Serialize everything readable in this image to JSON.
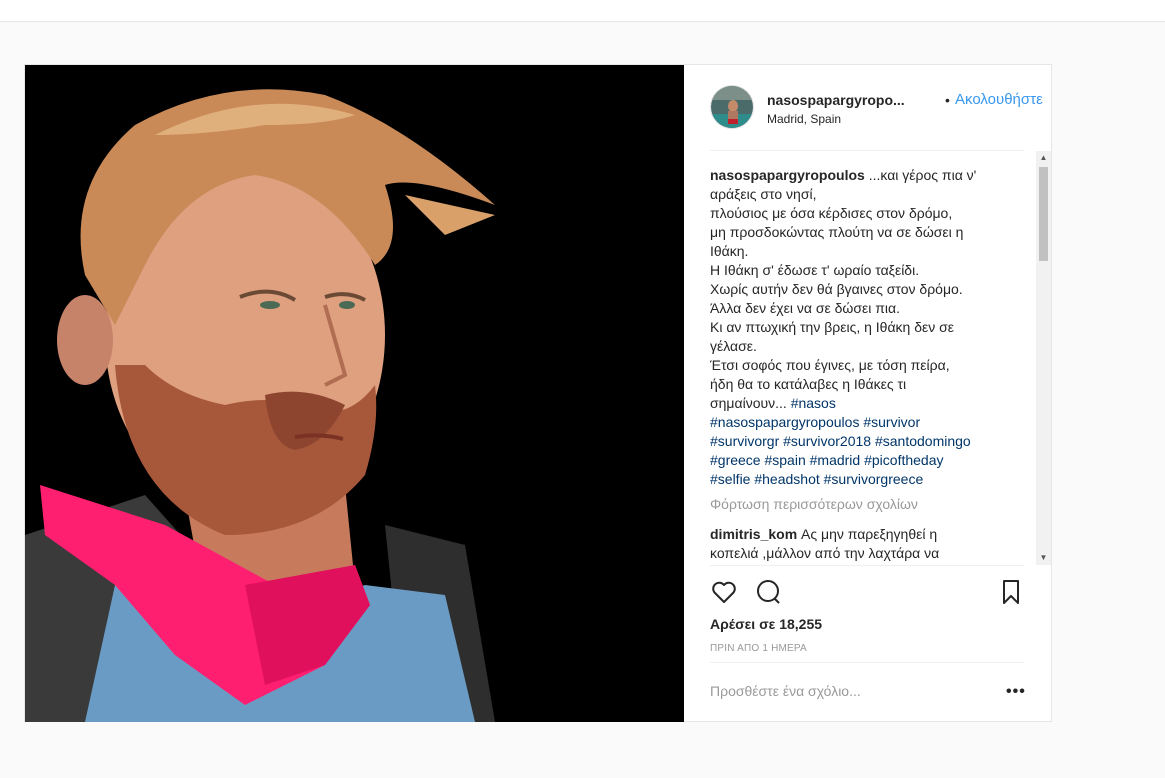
{
  "post": {
    "username": "nasospapargyropo...",
    "follow_separator": "•",
    "follow_label": "Ακολουθήστε",
    "location": "Madrid, Spain",
    "caption": {
      "username": "nasospapargyropoulos",
      "lines": [
        " ...και γέρος πια ν'",
        "αράξεις στο νησί,",
        "πλούσιος με όσα κέρδισες στον δρόμο,",
        "μη προσδοκώντας πλούτη να σε δώσει η",
        "Ιθάκη.",
        "Η Ιθάκη σ' έδωσε τ' ωραίο ταξείδι.",
        "Χωρίς αυτήν δεν θά βγαινες στον δρόμο.",
        "Άλλα δεν έχει να σε δώσει πια.",
        "Κι αν πτωχική την βρεις, η Ιθάκη δεν σε",
        "γέλασε.",
        "Έτσι σοφός που έγινες, με τόση πείρα,",
        "ήδη θα το κατάλαβες η Ιθάκες τι",
        "σημαίνουν... "
      ],
      "hashtags_line1": "#nasos",
      "hashtags_line2": "#nasospapargyropoulos #survivor",
      "hashtags_line3": "#survivorgr #survivor2018 #santodomingo",
      "hashtags_line4": "#greece #spain #madrid #picoftheday",
      "hashtags_line5": "#selfie #headshot #survivorgreece"
    },
    "load_more": "Φόρτωση περισσότερων σχολίων",
    "comment": {
      "username": "dimitris_kom",
      "text": " Ας μην παρεξηγηθεί η",
      "text2": "κοπελιά ,μάλλον από την λαχτάρα να"
    },
    "likes": "Αρέσει σε 18,255",
    "time_ago": "ΠΡΙΝ ΑΠΟ 1 ΗΜΕΡΑ",
    "add_comment_placeholder": "Προσθέστε ένα σχόλιο...",
    "more_options": "•••"
  },
  "icons": [
    "heart-icon",
    "comment-icon",
    "bookmark-icon",
    "scroll-up-arrow",
    "scroll-down-arrow"
  ],
  "colors": {
    "link_blue": "#3897f0",
    "hashtag": "#003569",
    "muted": "#999999"
  }
}
